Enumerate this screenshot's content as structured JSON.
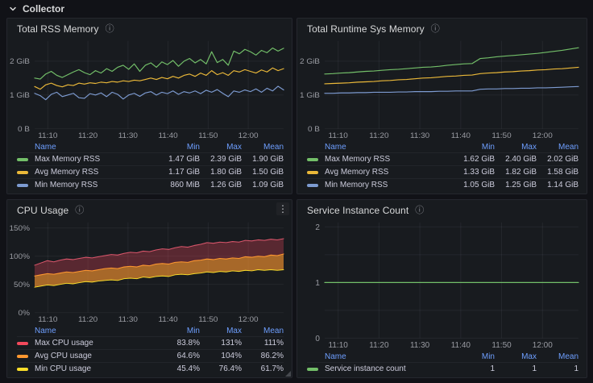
{
  "row_header": {
    "label": "Collector"
  },
  "icons": {
    "collapse_chevron": "chevron-down",
    "panel_info": "ⓘ",
    "panel_menu": "⋮"
  },
  "colors": {
    "page_bg": "#111217",
    "panel_bg": "#181b1f",
    "panel_border": "#25272e",
    "grid": "rgba(204,204,220,0.07)",
    "axis_text": "#9a9ca3",
    "legend_header": "#6e9fff",
    "legend_text": "#ccccdc",
    "green": "#73BF69",
    "yellow": "#EAB839",
    "blue": "#7D9BD1",
    "red": "#d9566b",
    "orange": "#FF9830",
    "bright_yellow": "#FADE2A"
  },
  "chart_data": [
    {
      "id": "total-rss-memory",
      "type": "line",
      "title": "Total RSS Memory",
      "ylim": [
        0,
        2.6
      ],
      "y_ticks": [
        {
          "value": 0,
          "label": "0 B"
        },
        {
          "value": 1,
          "label": "1 GiB"
        },
        {
          "value": 2,
          "label": "2 GiB"
        }
      ],
      "grid_y_values": [
        0,
        1,
        2
      ],
      "x_ticks": [
        "11:10",
        "11:20",
        "11:30",
        "11:40",
        "11:50",
        "12:00"
      ],
      "x_tick_fractions": [
        0.053,
        0.214,
        0.375,
        0.536,
        0.697,
        0.858
      ],
      "series": [
        {
          "name": "Max Memory RSS",
          "color": "#73BF69",
          "width": 1.2,
          "values": [
            1.5,
            1.47,
            1.62,
            1.7,
            1.58,
            1.52,
            1.6,
            1.68,
            1.75,
            1.66,
            1.6,
            1.72,
            1.65,
            1.78,
            1.7,
            1.82,
            1.88,
            1.76,
            1.92,
            1.7,
            1.88,
            1.95,
            1.82,
            1.98,
            1.9,
            2.02,
            1.85,
            2.0,
            2.08,
            1.95,
            2.05,
            1.92,
            2.28,
            1.96,
            2.05,
            1.88,
            2.3,
            2.22,
            2.35,
            2.28,
            2.18,
            2.32,
            2.25,
            2.39,
            2.3,
            2.38
          ]
        },
        {
          "name": "Avg Memory RSS",
          "color": "#EAB839",
          "width": 1.2,
          "values": [
            1.25,
            1.17,
            1.3,
            1.35,
            1.28,
            1.24,
            1.3,
            1.28,
            1.35,
            1.32,
            1.36,
            1.34,
            1.38,
            1.36,
            1.4,
            1.38,
            1.42,
            1.4,
            1.44,
            1.42,
            1.46,
            1.5,
            1.46,
            1.52,
            1.48,
            1.55,
            1.5,
            1.58,
            1.62,
            1.55,
            1.65,
            1.58,
            1.72,
            1.6,
            1.66,
            1.58,
            1.72,
            1.68,
            1.75,
            1.7,
            1.65,
            1.74,
            1.68,
            1.8,
            1.72,
            1.78
          ]
        },
        {
          "name": "Min Memory RSS",
          "color": "#7D9BD1",
          "width": 1.2,
          "values": [
            1.05,
            0.98,
            0.86,
            1.02,
            1.08,
            0.95,
            1.0,
            1.05,
            0.92,
            0.9,
            1.04,
            1.0,
            1.06,
            0.95,
            1.08,
            1.02,
            0.88,
            1.0,
            1.05,
            0.96,
            1.06,
            1.1,
            1.0,
            1.08,
            1.04,
            1.12,
            1.02,
            1.1,
            1.06,
            1.12,
            1.04,
            1.14,
            1.08,
            1.16,
            1.05,
            0.95,
            1.12,
            1.08,
            1.15,
            1.1,
            1.18,
            1.08,
            1.2,
            1.12,
            1.26,
            1.15
          ]
        }
      ],
      "legend": {
        "headers": [
          "Name",
          "Min",
          "Max",
          "Mean"
        ],
        "rows": [
          {
            "name": "Max Memory RSS",
            "color": "#73BF69",
            "min": "1.47 GiB",
            "max": "2.39 GiB",
            "mean": "1.90 GiB"
          },
          {
            "name": "Avg Memory RSS",
            "color": "#EAB839",
            "min": "1.17 GiB",
            "max": "1.80 GiB",
            "mean": "1.50 GiB"
          },
          {
            "name": "Min Memory RSS",
            "color": "#7D9BD1",
            "min": "860 MiB",
            "max": "1.26 GiB",
            "mean": "1.09 GiB"
          }
        ]
      }
    },
    {
      "id": "total-runtime-sys-memory",
      "type": "line",
      "title": "Total Runtime Sys Memory",
      "ylim": [
        0,
        2.6
      ],
      "y_ticks": [
        {
          "value": 0,
          "label": "0 B"
        },
        {
          "value": 1,
          "label": "1 GiB"
        },
        {
          "value": 2,
          "label": "2 GiB"
        }
      ],
      "grid_y_values": [
        0,
        1,
        2
      ],
      "x_ticks": [
        "11:10",
        "11:20",
        "11:30",
        "11:40",
        "11:50",
        "12:00"
      ],
      "x_tick_fractions": [
        0.053,
        0.214,
        0.375,
        0.536,
        0.697,
        0.858
      ],
      "series": [
        {
          "name": "Max Memory RSS",
          "color": "#73BF69",
          "width": 1.2,
          "values": [
            1.62,
            1.63,
            1.65,
            1.66,
            1.68,
            1.7,
            1.71,
            1.73,
            1.75,
            1.76,
            1.78,
            1.8,
            1.82,
            1.83,
            1.85,
            1.88,
            1.9,
            1.92,
            1.93,
            2.08,
            2.1,
            2.13,
            2.15,
            2.17,
            2.19,
            2.21,
            2.23,
            2.26,
            2.29,
            2.32,
            2.36,
            2.4
          ]
        },
        {
          "name": "Avg Memory RSS",
          "color": "#EAB839",
          "width": 1.2,
          "values": [
            1.33,
            1.34,
            1.35,
            1.36,
            1.38,
            1.39,
            1.4,
            1.42,
            1.43,
            1.45,
            1.46,
            1.48,
            1.5,
            1.51,
            1.53,
            1.55,
            1.56,
            1.58,
            1.59,
            1.63,
            1.65,
            1.66,
            1.68,
            1.69,
            1.71,
            1.72,
            1.74,
            1.75,
            1.77,
            1.78,
            1.8,
            1.82
          ]
        },
        {
          "name": "Min Memory RSS",
          "color": "#7D9BD1",
          "width": 1.2,
          "values": [
            1.05,
            1.05,
            1.06,
            1.06,
            1.07,
            1.07,
            1.08,
            1.08,
            1.08,
            1.09,
            1.09,
            1.1,
            1.1,
            1.1,
            1.11,
            1.11,
            1.12,
            1.12,
            1.12,
            1.17,
            1.18,
            1.18,
            1.19,
            1.19,
            1.2,
            1.2,
            1.21,
            1.21,
            1.22,
            1.23,
            1.24,
            1.25
          ]
        }
      ],
      "legend": {
        "headers": [
          "Name",
          "Min",
          "Max",
          "Mean"
        ],
        "rows": [
          {
            "name": "Max Memory RSS",
            "color": "#73BF69",
            "min": "1.62 GiB",
            "max": "2.40 GiB",
            "mean": "2.02 GiB"
          },
          {
            "name": "Avg Memory RSS",
            "color": "#EAB839",
            "min": "1.33 GiB",
            "max": "1.82 GiB",
            "mean": "1.58 GiB"
          },
          {
            "name": "Min Memory RSS",
            "color": "#7D9BD1",
            "min": "1.05 GiB",
            "max": "1.25 GiB",
            "mean": "1.14 GiB"
          }
        ]
      }
    },
    {
      "id": "cpu-usage",
      "type": "area",
      "title": "CPU Usage",
      "has_menu": true,
      "ylim": [
        0,
        160
      ],
      "y_ticks": [
        {
          "value": 0,
          "label": "0%"
        },
        {
          "value": 50,
          "label": "50%"
        },
        {
          "value": 100,
          "label": "100%"
        },
        {
          "value": 150,
          "label": "150%"
        }
      ],
      "grid_y_values": [
        0,
        50,
        100,
        150
      ],
      "x_ticks": [
        "11:10",
        "11:20",
        "11:30",
        "11:40",
        "11:50",
        "12:00"
      ],
      "x_tick_fractions": [
        0.053,
        0.214,
        0.375,
        0.536,
        0.697,
        0.858
      ],
      "series": [
        {
          "name": "Max CPU usage",
          "color": "#d9566b",
          "width": 1.1,
          "fill_to_series": 1,
          "fill_color": "rgba(242,73,92,0.30)",
          "values": [
            84,
            88,
            92,
            90,
            93,
            95,
            94,
            96,
            98,
            97,
            99,
            101,
            103,
            102,
            105,
            107,
            106,
            109,
            108,
            111,
            113,
            112,
            115,
            117,
            116,
            119,
            121,
            124,
            123,
            125,
            124,
            126,
            125,
            128,
            127,
            129,
            128,
            130,
            129,
            131
          ]
        },
        {
          "name": "Avg CPU usage",
          "color": "#FF9830",
          "width": 1.1,
          "fill_to_series": 2,
          "fill_color": "rgba(255,152,48,0.62)",
          "values": [
            65,
            67,
            69,
            68,
            70,
            72,
            71,
            73,
            75,
            74,
            76,
            78,
            79,
            78,
            81,
            82,
            81,
            84,
            83,
            86,
            87,
            86,
            89,
            90,
            89,
            92,
            93,
            95,
            94,
            96,
            95,
            97,
            96,
            99,
            98,
            100,
            99,
            102,
            101,
            104
          ]
        },
        {
          "name": "Min CPU usage",
          "color": "#FADE2A",
          "width": 1.0,
          "values": [
            45,
            47,
            49,
            48,
            50,
            52,
            51,
            53,
            55,
            54,
            56,
            57,
            58,
            57,
            60,
            61,
            60,
            63,
            62,
            64,
            65,
            64,
            67,
            68,
            67,
            69,
            70,
            72,
            71,
            73,
            72,
            74,
            73,
            75,
            74,
            76,
            75,
            76,
            75,
            76
          ]
        }
      ],
      "legend": {
        "headers": [
          "Name",
          "Min",
          "Max",
          "Mean"
        ],
        "rows": [
          {
            "name": "Max CPU usage",
            "color": "#F2495C",
            "min": "83.8%",
            "max": "131%",
            "mean": "111%"
          },
          {
            "name": "Avg CPU usage",
            "color": "#FF9830",
            "min": "64.6%",
            "max": "104%",
            "mean": "86.2%"
          },
          {
            "name": "Min CPU usage",
            "color": "#FADE2A",
            "min": "45.4%",
            "max": "76.4%",
            "mean": "61.7%"
          }
        ]
      }
    },
    {
      "id": "service-instance-count",
      "type": "line",
      "title": "Service Instance Count",
      "ylim": [
        0,
        2.08
      ],
      "y_ticks": [
        {
          "value": 0,
          "label": "0"
        },
        {
          "value": 1,
          "label": "1"
        },
        {
          "value": 2,
          "label": "2"
        }
      ],
      "grid_y_values": [
        0,
        0.5,
        1,
        1.5,
        2
      ],
      "x_ticks": [
        "11:10",
        "11:20",
        "11:30",
        "11:40",
        "11:50",
        "12:00"
      ],
      "x_tick_fractions": [
        0.053,
        0.214,
        0.375,
        0.536,
        0.697,
        0.858
      ],
      "series": [
        {
          "name": "Service instance count",
          "color": "#73BF69",
          "width": 1.2,
          "values": [
            1,
            1
          ]
        }
      ],
      "legend": {
        "headers": [
          "Name",
          "Min",
          "Max",
          "Mean"
        ],
        "rows": [
          {
            "name": "Service instance count",
            "color": "#73BF69",
            "min": "1",
            "max": "1",
            "mean": "1"
          }
        ]
      }
    }
  ]
}
